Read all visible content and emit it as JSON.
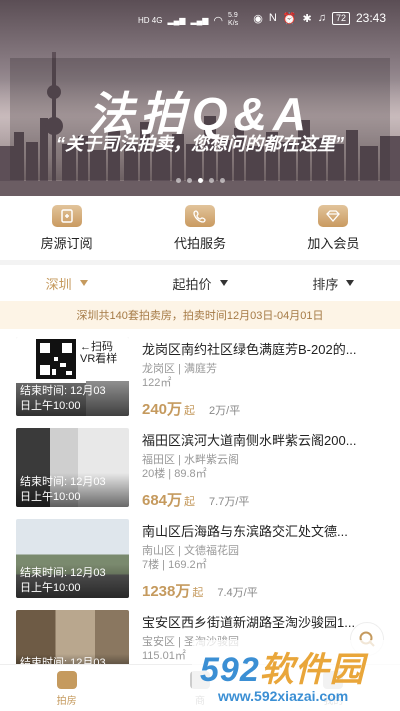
{
  "status_bar": {
    "signal_left": "HD 4G",
    "speed_value": "5.9",
    "speed_unit": "K/s",
    "battery": "72",
    "time": "23:43"
  },
  "banner": {
    "title": "法拍Q&A",
    "subtitle": "“关于司法拍卖，您想问的都在这里”",
    "page_index": 2,
    "page_count": 5
  },
  "actions": [
    {
      "label": "房源订阅",
      "icon": "subscribe-icon"
    },
    {
      "label": "代拍服务",
      "icon": "phone-icon"
    },
    {
      "label": "加入会员",
      "icon": "diamond-icon"
    }
  ],
  "filters": [
    {
      "label": "深圳",
      "active": true
    },
    {
      "label": "起拍价",
      "active": false
    },
    {
      "label": "排序",
      "active": false
    }
  ],
  "summary": "深圳共140套拍卖房，拍卖时间12月03日-04月01日",
  "listings": [
    {
      "title": "龙岗区南约社区绿色满庭芳B-202的...",
      "meta1": "龙岗区 | 满庭芳",
      "meta2": "122㎡",
      "price": "240万",
      "price_suffix": "起",
      "unit_price": "2万/平",
      "end_label": "结束时间: 12月03",
      "end_label2": "日上午10:00",
      "qr_text1": "扫码",
      "qr_text2": "VR看样"
    },
    {
      "title": "福田区滨河大道南侧水畔紫云阁200...",
      "meta1": "福田区 | 水畔紫云阁",
      "meta2": "20楼 | 89.8㎡",
      "price": "684万",
      "price_suffix": "起",
      "unit_price": "7.7万/平",
      "end_label": "结束时间: 12月03",
      "end_label2": "日上午10:00"
    },
    {
      "title": "南山区后海路与东滨路交汇处文德...",
      "meta1": "南山区 | 文德福花园",
      "meta2": "7楼 | 169.2㎡",
      "price": "1238万",
      "price_suffix": "起",
      "unit_price": "7.4万/平",
      "end_label": "结束时间: 12月03",
      "end_label2": "日上午10:00"
    },
    {
      "title": "宝安区西乡街道新湖路圣淘沙骏园1...",
      "meta1": "宝安区 | 圣淘沙骏园",
      "meta2": "115.01㎡",
      "price": "",
      "price_suffix": "",
      "unit_price": "",
      "end_label": "结束时间: 12月03",
      "end_label2": ""
    }
  ],
  "tabs": [
    {
      "label": "拍房",
      "active": true
    },
    {
      "label": "商",
      "active": false
    },
    {
      "label": "我的",
      "active": false
    }
  ],
  "watermark": {
    "brand_num": "592",
    "brand_text": "软件园",
    "url": "www.592xiazai.com"
  }
}
